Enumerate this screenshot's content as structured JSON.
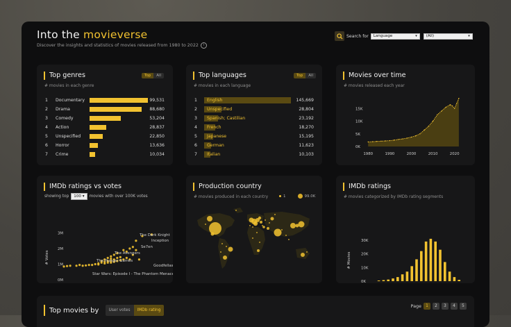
{
  "header": {
    "title_prefix": "Into the ",
    "title_accent": "movieverse",
    "subtitle": "Discover the insights and statistics of movies released from 1980 to 2022",
    "info_icon": "i",
    "search_label": "Search for",
    "search_field": "Language",
    "search_value": "(All)"
  },
  "colors": {
    "accent": "#f2c230",
    "panel": "#171718",
    "background": "#0e0e0f"
  },
  "top_genres": {
    "title": "Top genres",
    "subtitle": "# movies in each genre",
    "toggle": [
      "Top",
      "All"
    ],
    "rows": [
      {
        "rank": "1",
        "name": "Documentary",
        "value": "99,531",
        "n": 99531
      },
      {
        "rank": "2",
        "name": "Drama",
        "value": "88,680",
        "n": 88680
      },
      {
        "rank": "3",
        "name": "Comedy",
        "value": "53,204",
        "n": 53204
      },
      {
        "rank": "4",
        "name": "Action",
        "value": "28,837",
        "n": 28837
      },
      {
        "rank": "5",
        "name": "Unspecified",
        "value": "22,850",
        "n": 22850
      },
      {
        "rank": "6",
        "name": "Horror",
        "value": "13,636",
        "n": 13636
      },
      {
        "rank": "7",
        "name": "Crime",
        "value": "10,034",
        "n": 10034
      }
    ]
  },
  "top_languages": {
    "title": "Top languages",
    "subtitle": "# movies in each language",
    "toggle": [
      "Top",
      "All"
    ],
    "rows": [
      {
        "rank": "1",
        "name": "English",
        "value": "145,669",
        "n": 145669
      },
      {
        "rank": "2",
        "name": "Unspecified",
        "value": "28,804",
        "n": 28804
      },
      {
        "rank": "3",
        "name": "Spanish; Castilian",
        "value": "23,192",
        "n": 23192
      },
      {
        "rank": "4",
        "name": "French",
        "value": "18,270",
        "n": 18270
      },
      {
        "rank": "5",
        "name": "Japanese",
        "value": "15,195",
        "n": 15195
      },
      {
        "rank": "6",
        "name": "German",
        "value": "11,623",
        "n": 11623
      },
      {
        "rank": "7",
        "name": "Italian",
        "value": "10,103",
        "n": 10103
      }
    ]
  },
  "movies_over_time": {
    "title": "Movies over time",
    "subtitle": "# movies released each year",
    "x_ticks": [
      "1980",
      "1990",
      "2000",
      "2010",
      "2020"
    ],
    "y_ticks": [
      "0K",
      "5K",
      "10K",
      "15K"
    ]
  },
  "imdb_votes": {
    "title": "IMDb ratings vs votes",
    "showing_top_label": "showing top",
    "top_n": "100",
    "movies_label": "movies with over 100K votes",
    "y_label": "# Votes",
    "x_label": "IMDB Rating",
    "x_ticks": [
      "6.5",
      "7.0",
      "7.5",
      "8.0",
      "8.5",
      "9.0"
    ],
    "y_ticks": [
      "0M",
      "1M",
      "2M",
      "3M"
    ],
    "annotations": [
      "The Dark Knight",
      "Inception",
      "Se7en",
      "The Avengers",
      "The Hunger Games",
      "Star Wars: Episode I - The Phantom Menace",
      "Goodfellas"
    ]
  },
  "production_country": {
    "title": "Production country",
    "subtitle": "# movies produced in each country",
    "legend_small": "1",
    "legend_large": "99.0K"
  },
  "imdb_ratings": {
    "title": "IMDb ratings",
    "subtitle": "# movies categorized by IMDb rating segments",
    "y_label": "# Movies",
    "x_label": "IMDB Rating",
    "x_ticks": [
      "0.0",
      "2.0",
      "4.0",
      "6.0",
      "8.0",
      "10.0"
    ],
    "y_ticks": [
      "0K",
      "10K",
      "20K",
      "30K"
    ]
  },
  "top_movies": {
    "title": "Top movies by",
    "tabs": [
      "User votes",
      "IMDb rating"
    ],
    "page_label": "Page",
    "pages": [
      "1",
      "2",
      "3",
      "4",
      "5"
    ]
  },
  "chart_data": [
    {
      "type": "line",
      "title": "Movies over time",
      "x": [
        1980,
        1982,
        1984,
        1986,
        1988,
        1990,
        1992,
        1994,
        1996,
        1998,
        2000,
        2002,
        2004,
        2006,
        2008,
        2010,
        2012,
        2014,
        2016,
        2018,
        2019,
        2020,
        2021,
        2022
      ],
      "values": [
        1800,
        1900,
        2000,
        2100,
        2200,
        2300,
        2500,
        2800,
        3000,
        3300,
        3700,
        4200,
        5000,
        6500,
        8000,
        10000,
        12500,
        14000,
        15500,
        16500,
        16000,
        15000,
        17000,
        19000
      ],
      "ylim": [
        0,
        20000
      ],
      "xlim": [
        1978,
        2023
      ]
    },
    {
      "type": "scatter",
      "title": "IMDb ratings vs votes",
      "xlabel": "IMDB Rating",
      "ylabel": "# Votes",
      "xlim": [
        6.3,
        9.4
      ],
      "ylim": [
        0,
        3.2
      ],
      "points": [
        [
          6.5,
          0.85
        ],
        [
          6.6,
          0.88
        ],
        [
          6.7,
          0.9
        ],
        [
          6.9,
          0.9
        ],
        [
          7.0,
          0.95
        ],
        [
          7.1,
          0.9
        ],
        [
          7.2,
          0.92
        ],
        [
          7.3,
          0.95
        ],
        [
          7.4,
          0.95
        ],
        [
          7.5,
          1.0
        ],
        [
          7.6,
          1.05
        ],
        [
          7.6,
          0.98
        ],
        [
          7.7,
          1.1
        ],
        [
          7.7,
          1.2
        ],
        [
          7.8,
          1.05
        ],
        [
          7.8,
          1.15
        ],
        [
          7.8,
          1.3
        ],
        [
          7.9,
          1.1
        ],
        [
          7.9,
          1.2
        ],
        [
          7.9,
          1.4
        ],
        [
          8.0,
          1.1
        ],
        [
          8.0,
          1.2
        ],
        [
          8.0,
          1.35
        ],
        [
          8.0,
          1.5
        ],
        [
          8.1,
          1.15
        ],
        [
          8.1,
          1.3
        ],
        [
          8.1,
          1.6
        ],
        [
          8.2,
          1.2
        ],
        [
          8.2,
          1.4
        ],
        [
          8.2,
          1.7
        ],
        [
          8.3,
          1.25
        ],
        [
          8.3,
          1.45
        ],
        [
          8.4,
          1.3
        ],
        [
          8.4,
          1.9
        ],
        [
          8.5,
          1.4
        ],
        [
          8.5,
          1.8
        ],
        [
          8.6,
          1.3
        ],
        [
          8.6,
          2.0
        ],
        [
          8.7,
          2.1
        ],
        [
          8.7,
          1.6
        ],
        [
          8.8,
          2.5
        ],
        [
          8.8,
          1.9
        ],
        [
          8.9,
          1.3
        ],
        [
          9.0,
          2.8
        ],
        [
          9.3,
          2.9
        ]
      ]
    },
    {
      "type": "bar",
      "title": "IMDb ratings",
      "xlabel": "IMDB Rating",
      "ylabel": "# Movies",
      "categories": [
        "1.0",
        "1.5",
        "2.0",
        "2.5",
        "3.0",
        "3.5",
        "4.0",
        "4.5",
        "5.0",
        "5.5",
        "6.0",
        "6.5",
        "7.0",
        "7.5",
        "8.0",
        "8.5",
        "9.0",
        "9.5"
      ],
      "values": [
        500,
        800,
        1200,
        2000,
        3000,
        5000,
        7000,
        11000,
        16000,
        22000,
        29000,
        31000,
        29000,
        23000,
        14000,
        7000,
        3000,
        1000
      ],
      "ylim": [
        0,
        33000
      ]
    }
  ]
}
